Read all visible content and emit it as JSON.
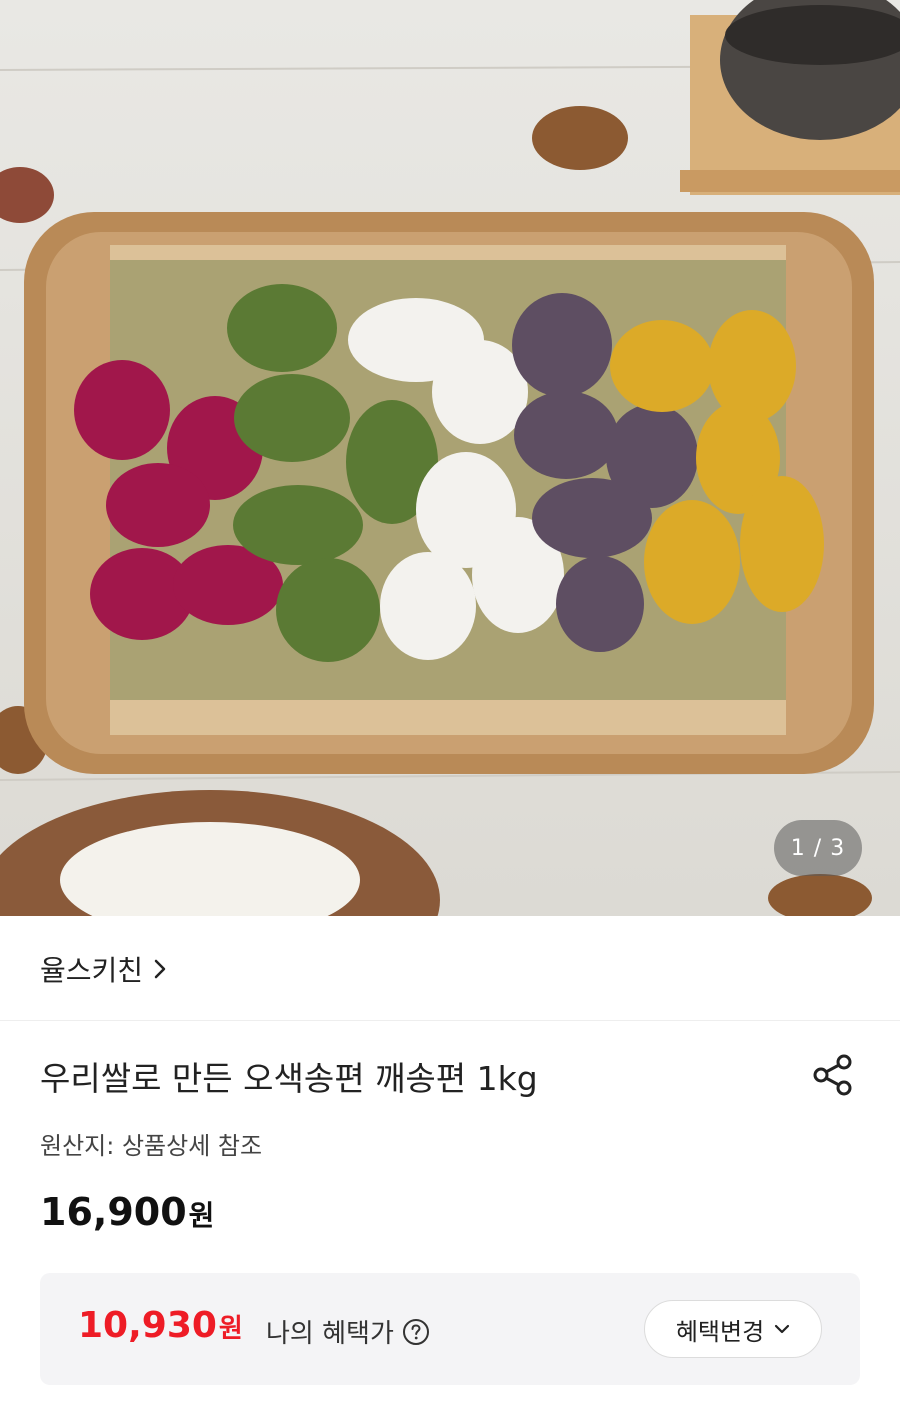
{
  "gallery": {
    "image_name": "product-photo-songpyeon",
    "current": "1",
    "separator": "/",
    "total": "3"
  },
  "seller": {
    "name": "율스키친"
  },
  "product": {
    "title": "우리쌀로 만든 오색송편 깨송편 1kg",
    "origin": "원산지: 상품상세 참조",
    "price": "16,900",
    "price_unit": "원"
  },
  "benefit": {
    "price": "10,930",
    "price_unit": "원",
    "label": "나의 혜택가",
    "change_label": "혜택변경"
  },
  "icons": {
    "share": "share-icon",
    "help": "question-circle-icon",
    "chevron_right": "chevron-right-icon",
    "chevron_down": "chevron-down-icon"
  },
  "colors": {
    "accent_red": "#ee1c26",
    "benefit_bg": "#f4f4f6"
  }
}
